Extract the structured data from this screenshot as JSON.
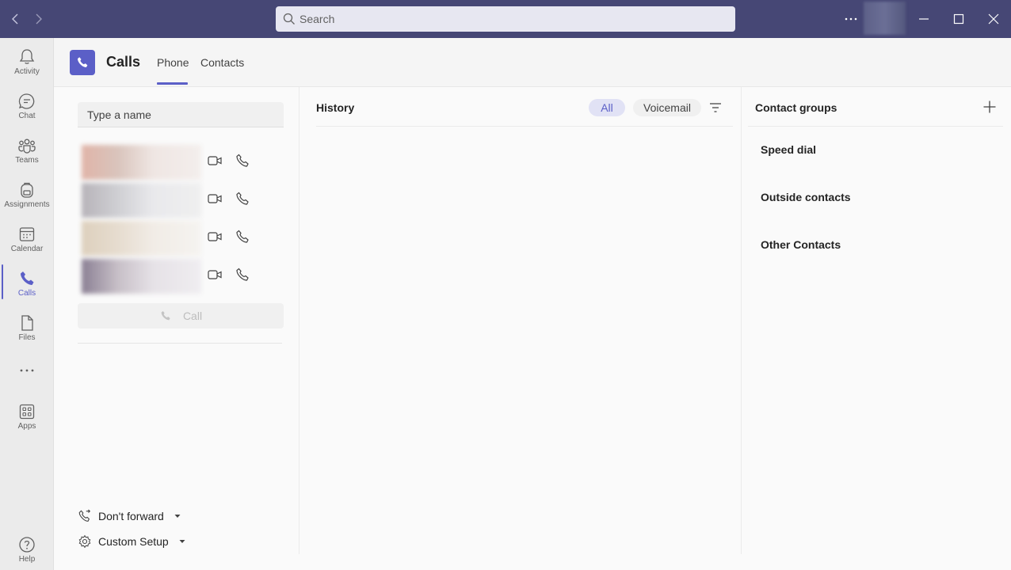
{
  "titlebar": {
    "search_placeholder": "Search",
    "accent": "#464775"
  },
  "rail": {
    "items": [
      {
        "label": "Activity",
        "icon": "bell-icon"
      },
      {
        "label": "Chat",
        "icon": "chat-icon"
      },
      {
        "label": "Teams",
        "icon": "teams-icon"
      },
      {
        "label": "Assignments",
        "icon": "backpack-icon"
      },
      {
        "label": "Calendar",
        "icon": "calendar-icon"
      },
      {
        "label": "Calls",
        "icon": "phone-icon",
        "active": true
      },
      {
        "label": "Files",
        "icon": "file-icon"
      },
      {
        "label": "",
        "icon": "more-icon"
      },
      {
        "label": "Apps",
        "icon": "apps-icon"
      },
      {
        "label": "Help",
        "icon": "help-icon"
      }
    ]
  },
  "header": {
    "title": "Calls",
    "tabs": [
      {
        "label": "Phone",
        "active": true
      },
      {
        "label": "Contacts",
        "active": false
      }
    ]
  },
  "dial": {
    "name_placeholder": "Type a name",
    "call_label": "Call",
    "forward_label": "Don't forward",
    "setup_label": "Custom Setup"
  },
  "history": {
    "title": "History",
    "filters": [
      "All",
      "Voicemail"
    ],
    "active_filter": "All"
  },
  "groups": {
    "title": "Contact groups",
    "items": [
      "Speed dial",
      "Outside contacts",
      "Other Contacts"
    ]
  },
  "colors": {
    "brand": "#5b5fc7",
    "rail_bg": "#ebebeb",
    "content_bg": "#fafafa"
  }
}
